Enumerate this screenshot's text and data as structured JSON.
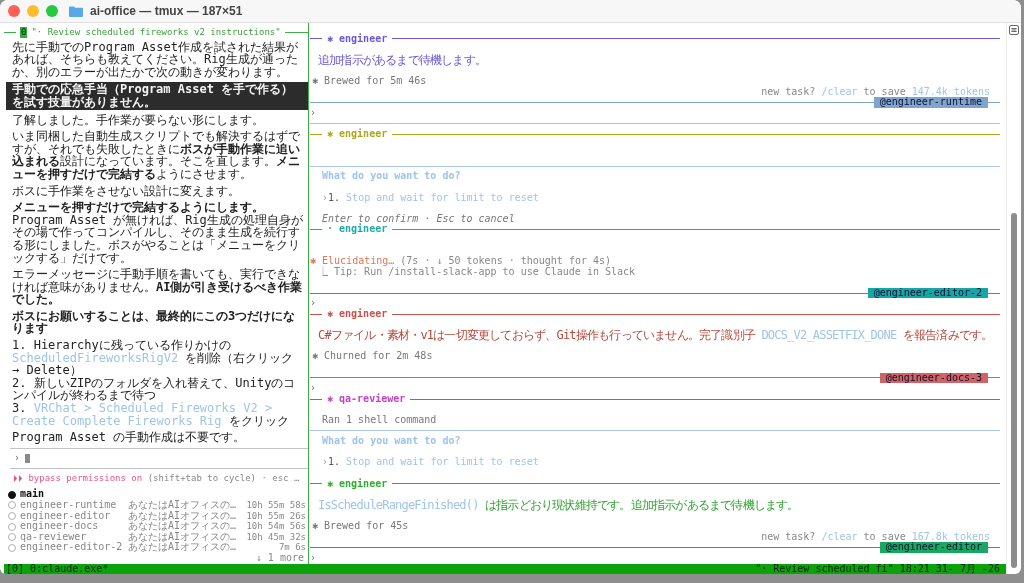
{
  "window": {
    "title": "ai-office — tmux — 187×51"
  },
  "left_pane": {
    "index": "0",
    "title": "\"· Review scheduled fireworks v2 instructions\"",
    "transcript": [
      {
        "kind": "text",
        "segments": [
          {
            "kind": "plain",
            "text": "先に手動でのProgram Asset作成を試された結果があれば、そちらも教えてください。Rig生成が通ったか、別のエラーが出たかで次の動きが変わります。"
          }
        ]
      },
      {
        "kind": "user",
        "segments": [
          {
            "kind": "plain",
            "text": "手動での応急手当（Program Asset を手で作る）を試す技量がありません。"
          }
        ]
      },
      {
        "kind": "text",
        "segments": [
          {
            "kind": "plain",
            "text": "了解しました。手作業が要らない形にします。"
          }
        ]
      },
      {
        "kind": "text",
        "segments": [
          {
            "kind": "plain",
            "text": "いま同梱した自動生成スクリプトでも解決するはずですが、それでも失敗したときに"
          },
          {
            "kind": "bold",
            "text": "ボスが手動作業に追い込まれる"
          },
          {
            "kind": "plain",
            "text": "設計になっています。そこを直します。"
          },
          {
            "kind": "bold",
            "text": "メニューを押すだけで完結する"
          },
          {
            "kind": "plain",
            "text": "ようにさせます。"
          }
        ]
      },
      {
        "kind": "text",
        "segments": [
          {
            "kind": "plain",
            "text": "ボスに手作業をさせない設計に変えます。"
          }
        ]
      },
      {
        "kind": "text",
        "segments": [
          {
            "kind": "bold",
            "text": "メニューを押すだけで完結するようにします。"
          },
          {
            "kind": "plain",
            "text": " Program Asset が無ければ、Rig生成の処理自身がその場で作ってコンパイルし、そのまま生成を続行する形にしました。ボスがやることは「メニューをクリックする」だけです。"
          }
        ]
      },
      {
        "kind": "text",
        "segments": [
          {
            "kind": "plain",
            "text": "エラーメッセージに手動手順を書いても、実行できなければ意味がありません。"
          },
          {
            "kind": "bold",
            "text": "AI側が引き受けるべき作業でした。"
          }
        ]
      },
      {
        "kind": "text",
        "segments": [
          {
            "kind": "bold",
            "text": "ボスにお願いすることは、最終的にこの3つだけになります"
          }
        ]
      },
      {
        "kind": "item",
        "segments": [
          {
            "kind": "plain",
            "text": "1. Hierarchyに残っている作りかけの "
          },
          {
            "kind": "code",
            "text": "ScheduledFireworksRigV2"
          },
          {
            "kind": "plain",
            "text": " を削除（右クリック → Delete）"
          }
        ]
      },
      {
        "kind": "item",
        "segments": [
          {
            "kind": "plain",
            "text": "2. 新しいZIPのフォルダを入れ替えて、Unityのコンパイルが終わるまで待つ"
          }
        ]
      },
      {
        "kind": "item",
        "segments": [
          {
            "kind": "plain",
            "text": "3. "
          },
          {
            "kind": "code",
            "text": "VRChat > Scheduled Fireworks V2 > Create Complete Fireworks Rig"
          },
          {
            "kind": "plain",
            "text": " をクリック"
          }
        ]
      },
      {
        "kind": "text",
        "segments": [
          {
            "kind": "plain",
            "text": "Program Asset の手動作成は不要です。"
          }
        ]
      }
    ],
    "prompt": "›",
    "mode_line": [
      {
        "kind": "accent",
        "text": "⏵⏵ bypass permissions on"
      },
      {
        "kind": "plain",
        "text": " (shift+tab to cycle) · esc …"
      }
    ],
    "sessions": [
      {
        "name": "main",
        "selected": true
      },
      {
        "name": "engineer-runtime",
        "selected": false,
        "summary": "あなたはAIオフィスの…",
        "elapsed": "10h 55m 58s"
      },
      {
        "name": "engineer-editor",
        "selected": false,
        "summary": "あなたはAIオフィスの…",
        "elapsed": "10h 55m 26s"
      },
      {
        "name": "engineer-docs",
        "selected": false,
        "summary": "あなたはAIオフィスの…",
        "elapsed": "10h 54m 56s"
      },
      {
        "name": "qa-reviewer",
        "selected": false,
        "summary": "あなたはAIオフィスの…",
        "elapsed": "10h 45m 32s"
      },
      {
        "name": "engineer-editor-2",
        "selected": false,
        "summary": "あなたはAIオフィスの…",
        "elapsed": "7m 6s"
      }
    ],
    "more": "↓ 1 more"
  },
  "right_pane": {
    "blocks": [
      {
        "kind": "header",
        "glyph": "✱",
        "label": "engineer",
        "color": "#6a58d6"
      },
      {
        "kind": "message",
        "color": "#6a58d6",
        "segments": [
          {
            "kind": "plain",
            "text": "追加指示があるまで待機します。"
          }
        ]
      },
      {
        "kind": "status",
        "glyph": "✱",
        "text": "Brewed for 5m 46s"
      },
      {
        "kind": "hint",
        "segments": [
          {
            "kind": "plain",
            "text": "new task? "
          },
          {
            "kind": "code",
            "text": "/clear"
          },
          {
            "kind": "plain",
            "text": " to save "
          },
          {
            "kind": "code",
            "text": "147.4k tokens"
          }
        ]
      },
      {
        "kind": "tag-rule",
        "tag": "@engineer-runtime",
        "color": "#7fa5cf"
      },
      {
        "kind": "prompt",
        "text": "›",
        "focused": false
      },
      {
        "kind": "rule",
        "color": "#a9c6e4"
      },
      {
        "kind": "header",
        "glyph": "✱",
        "label": "engineer",
        "color": "#a9a91c"
      },
      {
        "kind": "rule",
        "color": "#a9c6e4"
      },
      {
        "kind": "question",
        "text": "What do you want to do?"
      },
      {
        "kind": "option",
        "marker": "›",
        "number": "1.",
        "text": "Stop and wait for limit to reset"
      },
      {
        "kind": "footer",
        "text": "Enter to confirm · Esc to cancel"
      },
      {
        "kind": "header",
        "glyph": "·",
        "label": "engineer",
        "color": "#22a9a2"
      },
      {
        "kind": "spinner",
        "glyph": "✱",
        "label": "Elucidating…",
        "detail": " (7s · ↓ 50 tokens · thought for 4s)"
      },
      {
        "kind": "tip",
        "text": "⎿  Tip: Run /install-slack-app to use Claude in Slack"
      },
      {
        "kind": "tag-rule",
        "tag": "@engineer-editor-2",
        "color": "#17a6a6"
      },
      {
        "kind": "prompt",
        "text": "›",
        "focused": false
      },
      {
        "kind": "header",
        "glyph": "✱",
        "label": "engineer",
        "color": "#c4524c"
      },
      {
        "kind": "message",
        "color": "#b4493a",
        "segments": [
          {
            "kind": "plain",
            "text": "C#ファイル・素材・v1は一切変更しておらず、Git操作も行っていません。完了識別子 "
          },
          {
            "kind": "code",
            "text": "DOCS_V2_ASSETFIX_DONE"
          },
          {
            "kind": "plain",
            "text": " を報告済みです。"
          }
        ]
      },
      {
        "kind": "status",
        "glyph": "✱",
        "text": "Churned for 2m 48s"
      },
      {
        "kind": "tag-rule",
        "tag": "@engineer-docs-3",
        "color": "#d06464"
      },
      {
        "kind": "prompt",
        "text": "›",
        "focused": false
      },
      {
        "kind": "header",
        "glyph": "✱",
        "label": "qa-reviewer",
        "color": "#c044c4"
      },
      {
        "kind": "note",
        "text": "Ran 1 shell command"
      },
      {
        "kind": "rule",
        "color": "#a9c6e4"
      },
      {
        "kind": "question",
        "text": "What do you want to do?"
      },
      {
        "kind": "option",
        "marker": "›",
        "number": "1.",
        "text": "Stop and wait for limit to reset"
      },
      {
        "kind": "header",
        "glyph": "✱",
        "label": "engineer",
        "color": "#2fad2f"
      },
      {
        "kind": "message",
        "color": "#2fa32f",
        "segments": [
          {
            "kind": "code",
            "text": "IsScheduleRangeFinished()"
          },
          {
            "kind": "plain",
            "text": " は指示どおり現状維持です。追加指示があるまで待機します。"
          }
        ]
      },
      {
        "kind": "status",
        "glyph": "✱",
        "text": "Brewed for 45s"
      },
      {
        "kind": "hint",
        "segments": [
          {
            "kind": "plain",
            "text": "new task? "
          },
          {
            "kind": "code",
            "text": "/clear"
          },
          {
            "kind": "plain",
            "text": " to save "
          },
          {
            "kind": "code",
            "text": "167.8k tokens"
          }
        ]
      },
      {
        "kind": "tag-rule",
        "tag": "@engineer-editor",
        "color": "#17a862"
      },
      {
        "kind": "prompt",
        "text": "›",
        "focused": true
      }
    ]
  },
  "status_bar": {
    "left": "[0] 0:claude.exe*",
    "right": "\"· Review scheduled fi\" 18:21 31- 7月 -26"
  }
}
